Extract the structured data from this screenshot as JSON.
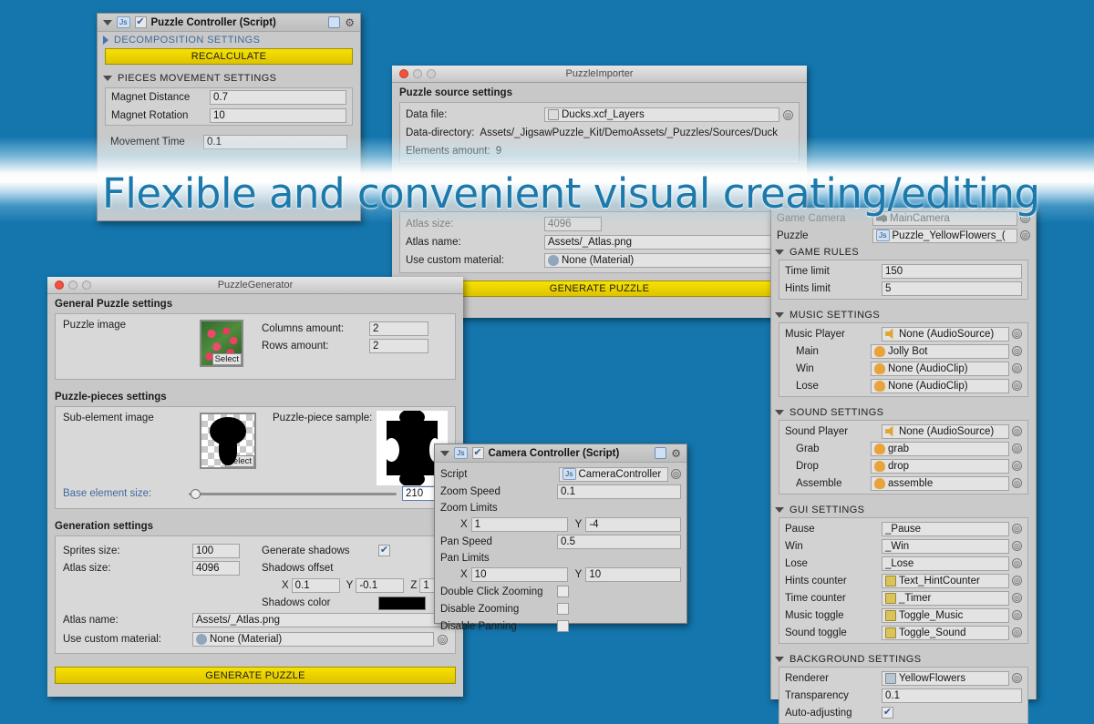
{
  "background": {
    "color": "#1476ad",
    "streak_color": "#ffffff"
  },
  "headline": {
    "text": "Flexible and convenient visual creating/editing",
    "color": "#1b79ab"
  },
  "puzzle_controller": {
    "title": "Puzzle Controller (Script)",
    "script_badge": "Js",
    "enabled": true,
    "help_icon": "help-book-icon",
    "gear_icon": "gear-icon",
    "decomposition_header": "DECOMPOSITION SETTINGS",
    "recalculate_button": "RECALCULATE",
    "pieces_header": "PIECES MOVEMENT SETTINGS",
    "fields": [
      {
        "label": "Magnet Distance",
        "value": "0.7"
      },
      {
        "label": "Magnet Rotation",
        "value": "10"
      }
    ],
    "movement_time": {
      "label": "Movement Time",
      "value": "0.1"
    }
  },
  "importer": {
    "title": "PuzzleImporter",
    "section_title": "Puzzle source  settings",
    "rows": [
      {
        "label": "Data file:",
        "value": "Ducks.xcf_Layers",
        "icon": "file-icon",
        "picker": true
      },
      {
        "label": "Data-directory:",
        "value": "Assets/_JigsawPuzzle_Kit/DemoAssets/_Puzzles/Sources/Duck"
      },
      {
        "label": "Elements amount:",
        "value": "9"
      }
    ],
    "atlas_size": {
      "label": "Atlas size:",
      "value": "4096"
    },
    "atlas_name": {
      "label": "Atlas name:",
      "value": "Assets/_Atlas.png"
    },
    "custom_material": {
      "label": "Use custom material:",
      "value": "None (Material)",
      "icon": "material-icon"
    },
    "generate_button": "GENERATE PUZZLE"
  },
  "generator": {
    "title": "PuzzleGenerator",
    "general_section": "General Puzzle settings",
    "puzzle_image_label": "Puzzle image",
    "select_label": "Select",
    "columns": {
      "label": "Columns amount:",
      "value": "2"
    },
    "rows": {
      "label": "Rows amount:",
      "value": "2"
    },
    "pieces_section": "Puzzle-pieces settings",
    "sub_element_label": "Sub-element image",
    "sample_label": "Puzzle-piece sample:",
    "base_element": {
      "label": "Base element size:",
      "value": "210"
    },
    "generation_section": "Generation settings",
    "sprites_size": {
      "label": "Sprites size:",
      "value": "100"
    },
    "atlas_size": {
      "label": "Atlas size:",
      "value": "4096"
    },
    "generate_shadows": {
      "label": "Generate shadows",
      "checked": true
    },
    "shadows_offset_label": "Shadows offset",
    "shadows_offset": {
      "x_label": "X",
      "x": "0.1",
      "y_label": "Y",
      "y": "-0.1",
      "z_label": "Z",
      "z": "1"
    },
    "shadows_color_label": "Shadows color",
    "shadows_color": "#000000",
    "atlas_name": {
      "label": "Atlas name:",
      "value": "Assets/_Atlas.png"
    },
    "custom_material": {
      "label": "Use custom material:",
      "value": "None (Material)"
    },
    "generate_button": "GENERATE PUZZLE"
  },
  "camera_controller": {
    "title": "Camera Controller (Script)",
    "script_badge": "Js",
    "enabled": true,
    "script": {
      "label": "Script",
      "value": "CameraController"
    },
    "zoom_speed": {
      "label": "Zoom Speed",
      "value": "0.1"
    },
    "zoom_limits_label": "Zoom Limits",
    "zoom_limits": {
      "x_label": "X",
      "x": "1",
      "y_label": "Y",
      "y": "-4"
    },
    "pan_speed": {
      "label": "Pan Speed",
      "value": "0.5"
    },
    "pan_limits_label": "Pan Limits",
    "pan_limits": {
      "x_label": "X",
      "x": "10",
      "y_label": "Y",
      "y": "10"
    },
    "toggles": [
      {
        "label": "Double Click Zooming",
        "checked": false
      },
      {
        "label": "Disable Zooming",
        "checked": false
      },
      {
        "label": "Disable Panning",
        "checked": false
      }
    ]
  },
  "inspector": {
    "top_rows": [
      {
        "label": "Game Camera",
        "value": "MainCamera",
        "icon": "camera-icon",
        "dim": true
      },
      {
        "label": "Puzzle",
        "value": "Puzzle_YellowFlowers_(",
        "icon": "script-icon",
        "dim": false
      }
    ],
    "sections": [
      {
        "header": "GAME  RULES",
        "rows": [
          {
            "label": "Time limit",
            "value": "150",
            "type": "text"
          },
          {
            "label": "Hints limit",
            "value": "5",
            "type": "text"
          }
        ]
      },
      {
        "header": "MUSIC  SETTINGS",
        "rows": [
          {
            "label": "Music Player",
            "value": "None (AudioSource)",
            "type": "obj",
            "icon": "audiosource-icon",
            "indent": 0
          },
          {
            "label": "Main",
            "value": "Jolly Bot",
            "type": "obj",
            "icon": "audioclip-icon",
            "indent": 1
          },
          {
            "label": "Win",
            "value": "None (AudioClip)",
            "type": "obj",
            "icon": "audioclip-icon",
            "indent": 1
          },
          {
            "label": "Lose",
            "value": "None (AudioClip)",
            "type": "obj",
            "icon": "audioclip-icon",
            "indent": 1
          }
        ]
      },
      {
        "header": "SOUND  SETTINGS",
        "rows": [
          {
            "label": "Sound Player",
            "value": "None (AudioSource)",
            "type": "obj",
            "icon": "audiosource-icon",
            "indent": 0
          },
          {
            "label": "Grab",
            "value": "grab",
            "type": "obj",
            "icon": "audioclip-icon",
            "indent": 1
          },
          {
            "label": "Drop",
            "value": "drop",
            "type": "obj",
            "icon": "audioclip-icon",
            "indent": 1
          },
          {
            "label": "Assemble",
            "value": "assemble",
            "type": "obj",
            "icon": "audioclip-icon",
            "indent": 1
          }
        ]
      },
      {
        "header": "GUI  SETTINGS",
        "rows": [
          {
            "label": "Pause",
            "value": "_Pause",
            "type": "obj",
            "icon": "none-icon",
            "indent": 0
          },
          {
            "label": "Win",
            "value": "_Win",
            "type": "obj",
            "icon": "none-icon",
            "indent": 0
          },
          {
            "label": "Lose",
            "value": "_Lose",
            "type": "obj",
            "icon": "none-icon",
            "indent": 0
          },
          {
            "label": "Hints counter",
            "value": "Text_HintCounter",
            "type": "obj",
            "icon": "text-icon",
            "indent": 0
          },
          {
            "label": "Time counter",
            "value": "_Timer",
            "type": "obj",
            "icon": "text-icon",
            "indent": 0
          },
          {
            "label": "Music toggle",
            "value": "Toggle_Music",
            "type": "obj",
            "icon": "toggle-icon",
            "indent": 0
          },
          {
            "label": "Sound toggle",
            "value": "Toggle_Sound",
            "type": "obj",
            "icon": "toggle-icon",
            "indent": 0
          }
        ]
      },
      {
        "header": "BACKGROUND  SETTINGS",
        "rows": [
          {
            "label": "Renderer",
            "value": "YellowFlowers",
            "type": "obj",
            "icon": "renderer-icon",
            "indent": 0
          },
          {
            "label": "Transparency",
            "value": "0.1",
            "type": "text"
          },
          {
            "label": "Auto-adjusting",
            "value": "",
            "type": "check",
            "checked": true
          }
        ]
      }
    ]
  }
}
